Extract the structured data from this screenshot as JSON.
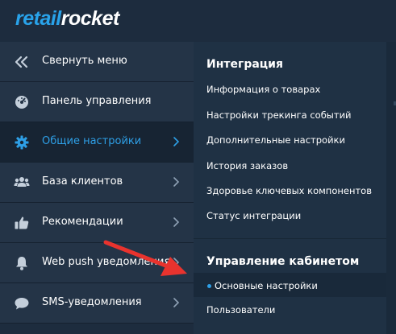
{
  "logo": {
    "part1": "retail",
    "part2": "rocket"
  },
  "sidebar": {
    "items": [
      {
        "label": "Свернуть меню",
        "icon": "collapse-icon"
      },
      {
        "label": "Панель управления",
        "icon": "dashboard-icon"
      },
      {
        "label": "Общие настройки",
        "icon": "gear-icon",
        "active": true
      },
      {
        "label": "База клиентов",
        "icon": "users-icon"
      },
      {
        "label": "Рекомендации",
        "icon": "thumbs-up-icon"
      },
      {
        "label": "Web push уведомления",
        "icon": "bell-icon"
      },
      {
        "label": "SMS-уведомления",
        "icon": "chat-icon"
      }
    ]
  },
  "panel": {
    "sections": [
      {
        "heading": "Интеграция",
        "links": [
          "Информация о товарах",
          "Настройки трекинга событий",
          "Дополнительные настройки",
          "История заказов",
          "Здоровье ключевых компонентов",
          "Статус интеграции"
        ]
      },
      {
        "heading": "Управление кабинетом",
        "links": [
          "Основные настройки",
          "Пользователи"
        ]
      }
    ],
    "active_link": "Основные настройки"
  },
  "colors": {
    "accent": "#2e9fe6",
    "arrow": "#e8332e",
    "background": "#1d2c3e"
  }
}
